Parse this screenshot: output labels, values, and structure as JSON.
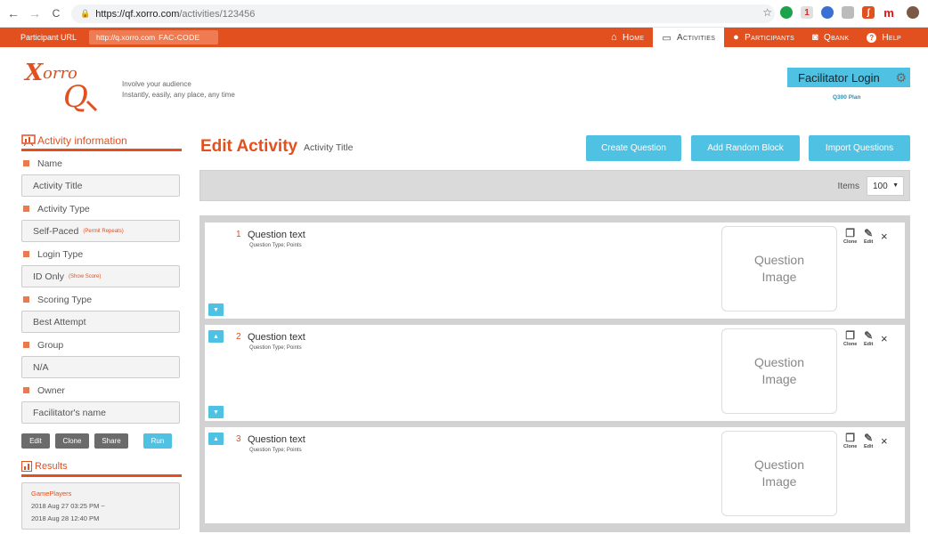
{
  "browser": {
    "back": "←",
    "forward": "→",
    "reload": "C",
    "url_host": "https://qf.xorro.com",
    "url_path": "/activities/123456",
    "star": "☆"
  },
  "topnav": {
    "participant_url_label": "Participant URL",
    "participant_url_value": "http://q.xorro.com",
    "participant_code": "FAC-CODE",
    "items": [
      {
        "label": "Home",
        "icon": "home-icon",
        "glyph": "⌂"
      },
      {
        "label": "Activities",
        "icon": "monitor-icon",
        "glyph": "▭"
      },
      {
        "label": "Participants",
        "icon": "person-icon",
        "glyph": "●"
      },
      {
        "label": "Qbank",
        "icon": "camera-icon",
        "glyph": "◙"
      },
      {
        "label": "Help",
        "icon": "help-icon",
        "glyph": "?"
      }
    ],
    "colors": {
      "bar": "#e2501f",
      "accent": "#4fc1e3"
    }
  },
  "header": {
    "logo_text": "XorroQ",
    "tagline_1": "Involve your audience",
    "tagline_2": "Instantly, easily, any place, any time",
    "facilitator_login": "Facilitator Login",
    "plan": "Q300 Plan"
  },
  "sidebar": {
    "title": "Activity information",
    "fields": [
      {
        "label": "Name",
        "value": "Activity Title",
        "note": ""
      },
      {
        "label": "Activity Type",
        "value": "Self-Paced",
        "note": "(Permit Repeats)"
      },
      {
        "label": "Login Type",
        "value": "ID Only",
        "note": "(Show Score)"
      },
      {
        "label": "Scoring Type",
        "value": "Best Attempt",
        "note": ""
      },
      {
        "label": "Group",
        "value": "N/A",
        "note": ""
      },
      {
        "label": "Owner",
        "value": "Facilitator's name",
        "note": ""
      }
    ],
    "buttons": {
      "edit": "Edit",
      "clone": "Clone",
      "share": "Share",
      "run": "Run"
    },
    "results_title": "Results",
    "result": {
      "name": "GamePlayers",
      "start": "2018 Aug 27 03:25 PM ~",
      "end": "2018 Aug 28 12:40 PM"
    }
  },
  "main": {
    "title": "Edit Activity",
    "subtitle": "Activity Title",
    "buttons": {
      "create": "Create Question",
      "random": "Add Random Block",
      "import": "Import Questions"
    },
    "items_label": "Items",
    "items_value": "100",
    "questions": [
      {
        "num": "1",
        "text": "Question text",
        "meta": "Question Type; Points",
        "image_1": "Question",
        "image_2": "Image"
      },
      {
        "num": "2",
        "text": "Question text",
        "meta": "Question Type; Points",
        "image_1": "Question",
        "image_2": "Image"
      },
      {
        "num": "3",
        "text": "Question text",
        "meta": "Question Type; Points",
        "image_1": "Question",
        "image_2": "Image"
      }
    ],
    "clone_label": "Clone",
    "edit_label": "Edit",
    "close": "×",
    "arrow_up": "▲",
    "arrow_down": "▼"
  }
}
